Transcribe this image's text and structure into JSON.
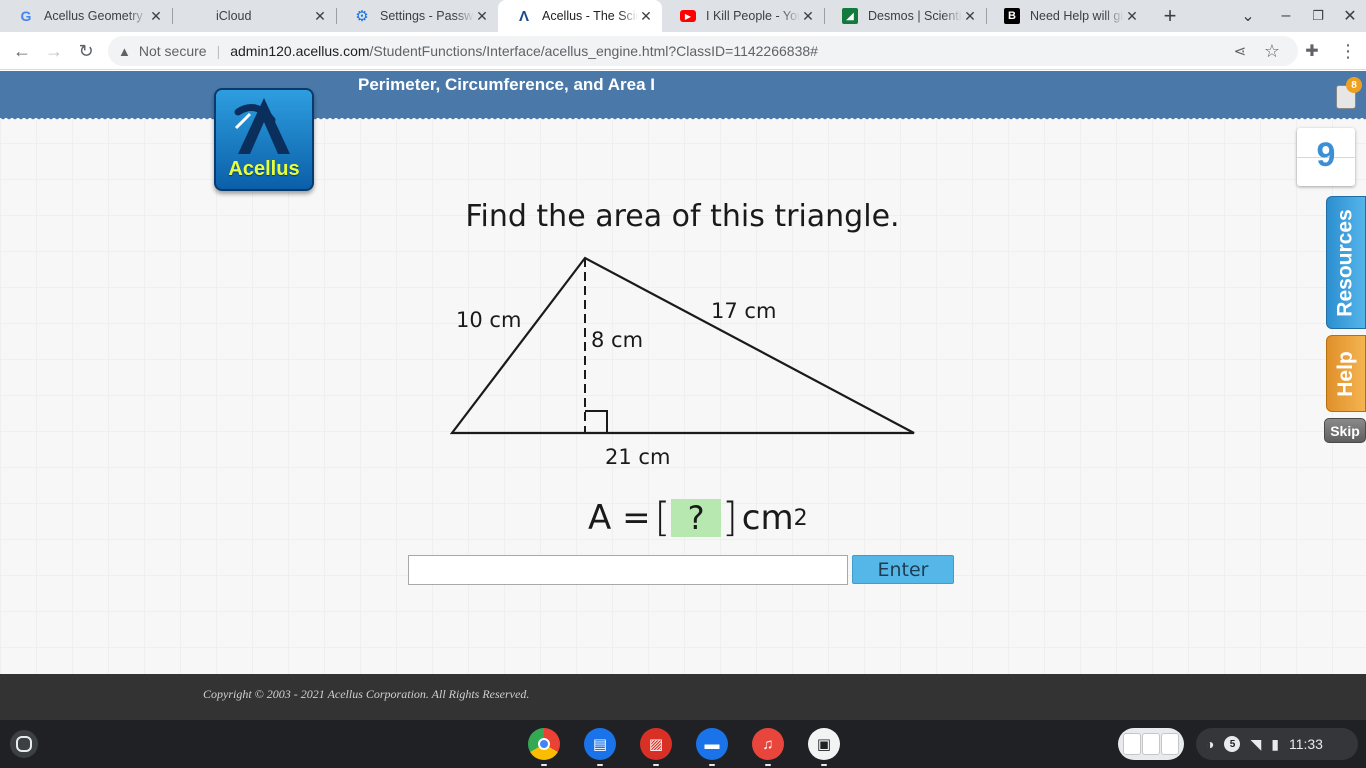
{
  "browser": {
    "tabs": [
      {
        "title": "Acellus Geometry - Google Search",
        "icon": "google-icon"
      },
      {
        "title": "iCloud",
        "icon": "apple-icon"
      },
      {
        "title": "Settings - Passwords",
        "icon": "gear-icon"
      },
      {
        "title": "Acellus - The Science of Learning",
        "icon": "acellus-icon",
        "active": true
      },
      {
        "title": "I Kill People - YouTube",
        "icon": "youtube-icon"
      },
      {
        "title": "Desmos | Scientific Calculator",
        "icon": "desmos-icon"
      },
      {
        "title": "Need Help will give brainliest",
        "icon": "brainly-icon"
      }
    ],
    "new_tab_symbol": "+",
    "address": {
      "security_label": "Not secure",
      "host": "admin120.acellus.com",
      "path": "/StudentFunctions/Interface/acellus_engine.html?ClassID=1142266838#"
    }
  },
  "lesson": {
    "title": "Perimeter, Circumference, and Area I",
    "logo_text": "Acellus",
    "notification_count": "8",
    "score": "9",
    "side_tabs": {
      "resources": "Resources",
      "help": "Help",
      "skip": "Skip"
    }
  },
  "problem": {
    "question": "Find the area of this triangle.",
    "labels": {
      "left_side": "10 cm",
      "right_side": "17 cm",
      "height": "8 cm",
      "base": "21 cm"
    },
    "equation": {
      "lhs": "A =",
      "placeholder": "?",
      "unit": "cm",
      "exponent": "2"
    },
    "answer_value": "",
    "enter_label": "Enter"
  },
  "footer": {
    "copyright": "Copyright © 2003 - 2021 Acellus Corporation.  All Rights Reserved."
  },
  "shelf": {
    "apps": [
      "chrome-icon",
      "messages-icon",
      "gallery-icon",
      "files-icon",
      "music-icon",
      "terminal-icon"
    ],
    "notification_count": "5",
    "time": "11:33"
  },
  "colors": {
    "lesson_bar": "#4a78a8",
    "accent_blue": "#55b7e8",
    "help_orange": "#f4b451",
    "answer_box": "#b6e8b0"
  }
}
